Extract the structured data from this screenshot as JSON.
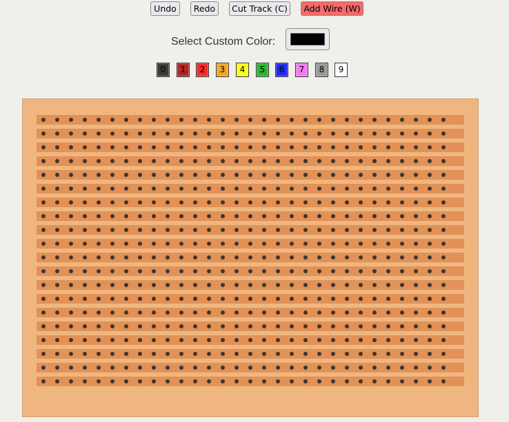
{
  "toolbar": {
    "undo_label": "Undo",
    "redo_label": "Redo",
    "cut_track_label": "Cut Track (C)",
    "add_wire_label": "Add Wire (W)",
    "active_tool": "add-wire"
  },
  "custom_color": {
    "label": "Select Custom Color:",
    "value": "#000000"
  },
  "palette": [
    {
      "label": "0",
      "color": "#3b3b3b"
    },
    {
      "label": "1",
      "color": "#b52424"
    },
    {
      "label": "2",
      "color": "#f02a2a"
    },
    {
      "label": "3",
      "color": "#f5a623"
    },
    {
      "label": "4",
      "color": "#ffff1a"
    },
    {
      "label": "5",
      "color": "#2db52d"
    },
    {
      "label": "6",
      "color": "#1f2bf0"
    },
    {
      "label": "7",
      "color": "#f27cf0"
    },
    {
      "label": "8",
      "color": "#9a9a9a"
    },
    {
      "label": "9",
      "color": "#ffffff"
    }
  ],
  "board": {
    "strips": 20,
    "holes_per_strip": 30,
    "board_color": "#efb77f",
    "strip_color": "#e29157",
    "hole_color": "#3c3530"
  }
}
